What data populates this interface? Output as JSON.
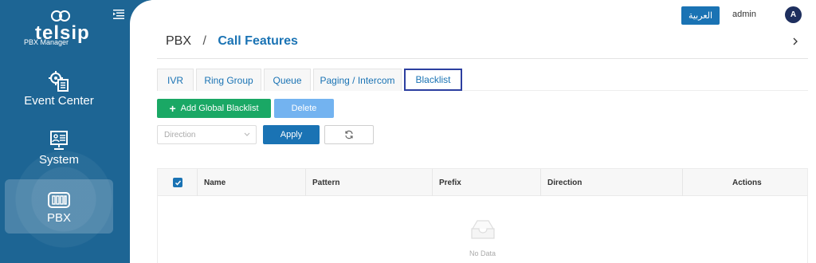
{
  "sidebar": {
    "logo_text": "telsip",
    "logo_subtitle": "PBX Manager",
    "items": [
      {
        "label": "Event Center",
        "icon": "settings-list-icon",
        "active": false
      },
      {
        "label": "System",
        "icon": "monitor-icon",
        "active": false
      },
      {
        "label": "PBX",
        "icon": "pbx-icon",
        "active": true
      }
    ]
  },
  "topbar": {
    "language_button": "العربية",
    "username": "admin",
    "avatar_initial": "A"
  },
  "breadcrumb": {
    "root": "PBX",
    "separator": "/",
    "current": "Call Features"
  },
  "tabs": [
    {
      "label": "IVR"
    },
    {
      "label": "Ring Group"
    },
    {
      "label": "Queue"
    },
    {
      "label": "Paging / Intercom"
    },
    {
      "label": "Blacklist",
      "active": true
    }
  ],
  "toolbar": {
    "add_label": "Add Global Blacklist",
    "delete_label": "Delete",
    "direction_placeholder": "Direction",
    "apply_label": "Apply"
  },
  "table": {
    "columns": [
      "Name",
      "Pattern",
      "Prefix",
      "Direction",
      "Actions"
    ],
    "empty_text": "No Data"
  },
  "colors": {
    "sidebar": "#1d6594",
    "primary": "#1a73b4",
    "success": "#1aa865",
    "disabled": "#73b3f0",
    "active_tab_border": "#2c3fa0"
  }
}
